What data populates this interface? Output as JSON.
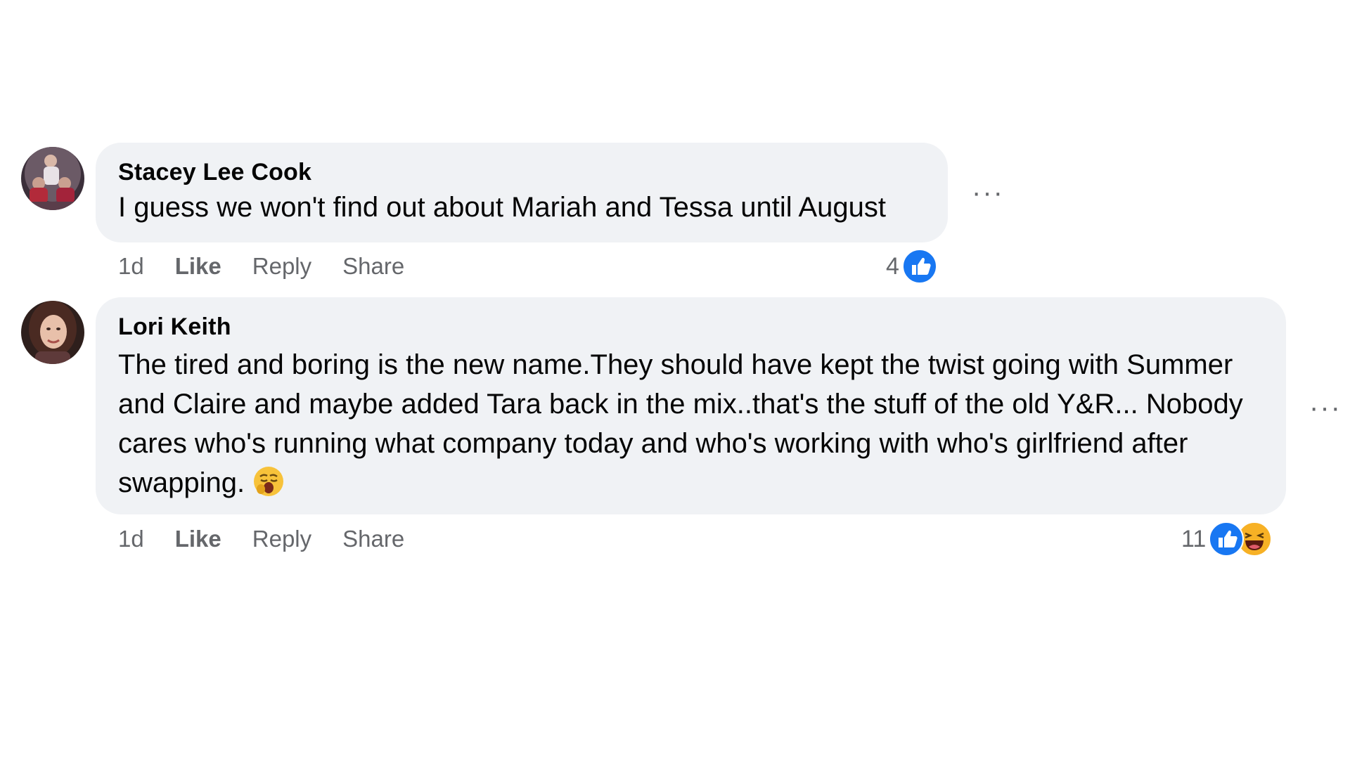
{
  "comments": [
    {
      "author": "Stacey Lee Cook",
      "text": "I guess we won't find out about Mariah and Tessa until August",
      "time": "1d",
      "like_label": "Like",
      "reply_label": "Reply",
      "share_label": "Share",
      "reaction_count": "4",
      "reactions": [
        "like-icon"
      ],
      "more_label": "···"
    },
    {
      "author": "Lori Keith",
      "text": "The tired and boring is the new name.They should have kept the twist going with Summer and Claire and maybe added Tara back in the mix..that's the stuff of the old Y&R... Nobody cares who's running what company today and who's working with who's girlfriend after swapping.",
      "emoji": "yawning-face-emoji",
      "time": "1d",
      "like_label": "Like",
      "reply_label": "Reply",
      "share_label": "Share",
      "reaction_count": "11",
      "reactions": [
        "like-icon",
        "haha-icon"
      ],
      "more_label": "···"
    }
  ],
  "colors": {
    "bubble": "#f0f2f5",
    "meta_text": "#65676b",
    "like_blue": "#1877f2",
    "haha_yellow": "#f7b125"
  }
}
